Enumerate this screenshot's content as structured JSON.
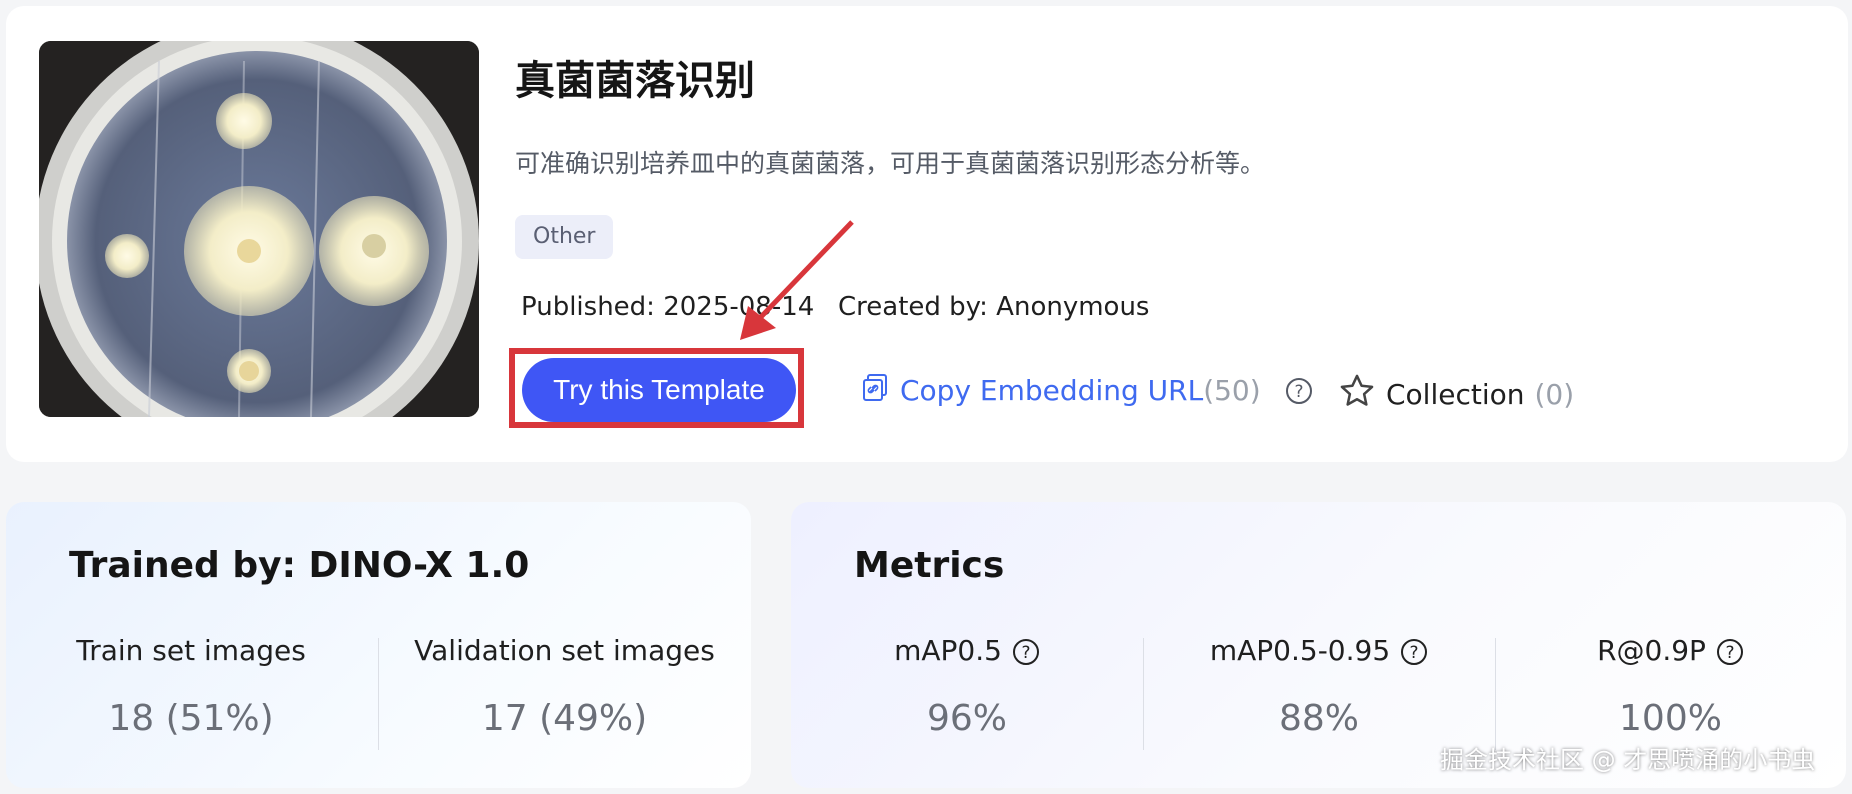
{
  "template": {
    "title": "真菌菌落识别",
    "description": "可准确识别培养皿中的真菌菌落，可用于真菌菌落识别形态分析等。",
    "tag": "Other",
    "published": "Published: 2025-08-14",
    "created_by": "Created by: Anonymous"
  },
  "actions": {
    "try_label": "Try this Template",
    "copy_label": "Copy Embedding URL",
    "copy_count": "(50)",
    "collection_label": "Collection",
    "collection_count": "(0)"
  },
  "training": {
    "title": "Trained by: DINO-X 1.0",
    "stats": [
      {
        "label": "Train set images",
        "value": "18 (51%)"
      },
      {
        "label": "Validation set images",
        "value": "17 (49%)"
      }
    ]
  },
  "metrics": {
    "title": "Metrics",
    "items": [
      {
        "label": "mAP0.5",
        "value": "96%"
      },
      {
        "label": "mAP0.5-0.95",
        "value": "88%"
      },
      {
        "label": "R@0.9P",
        "value": "100%"
      }
    ]
  },
  "watermark": "掘金技术社区 @ 才思喷涌的小书虫",
  "colors": {
    "primary_button": "#3f56f5",
    "link": "#3f6af0",
    "highlight_box": "#d8363b",
    "annotation_arrow": "#d8363b"
  }
}
